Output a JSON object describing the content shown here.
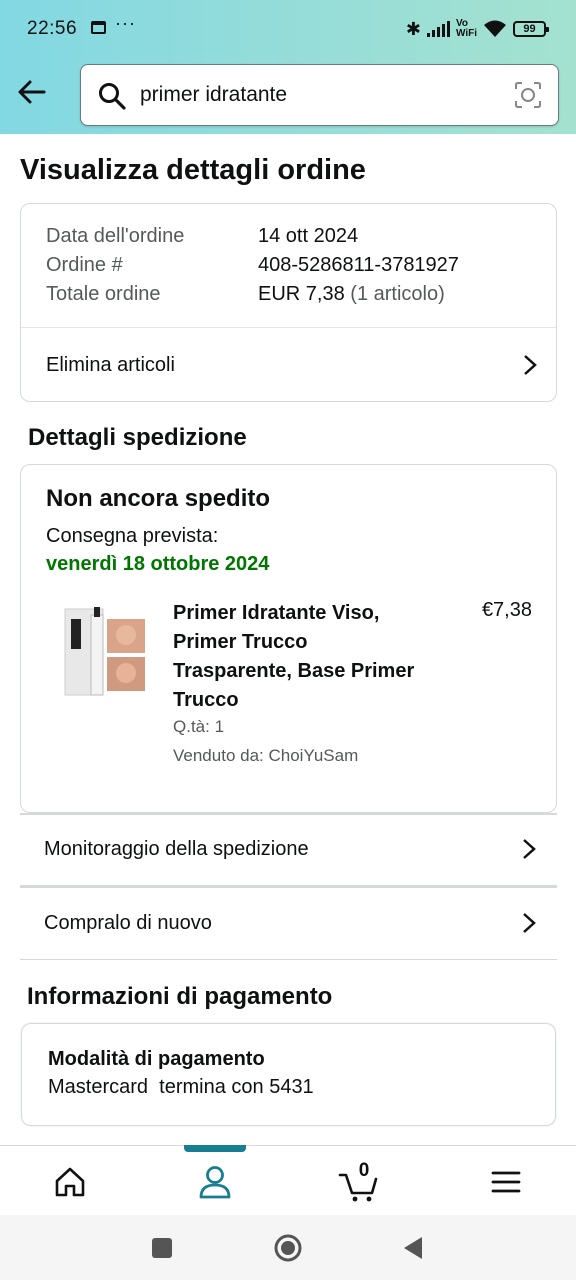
{
  "status_bar": {
    "time": "22:56",
    "more": "···",
    "network_label": "Vo\nWiFi",
    "battery": "99"
  },
  "search": {
    "query": "primer idratante"
  },
  "page": {
    "title": "Visualizza dettagli ordine"
  },
  "order_summary": {
    "rows": [
      {
        "label": "Data dell'ordine",
        "value": "14 ott 2024"
      },
      {
        "label": "Ordine #",
        "value": "408-5286811-3781927"
      },
      {
        "label": "Totale ordine",
        "value": "EUR 7,38",
        "extra": "(1 articolo)"
      }
    ],
    "delete_items": "Elimina articoli"
  },
  "shipping": {
    "section_title": "Dettagli spedizione",
    "status": "Non ancora spedito",
    "eta_label": "Consegna prevista:",
    "eta_date": "venerdì 18 ottobre 2024",
    "product": {
      "name": "Primer Idratante Viso, Primer Trucco Trasparente, Base Primer Trucco",
      "price": "€7,38",
      "qty": "Q.tà: 1",
      "seller": "Venduto da: ChoiYuSam"
    },
    "tracking": "Monitoraggio della spedizione",
    "buy_again": "Compralo di nuovo"
  },
  "payment": {
    "section_title": "Informazioni di pagamento",
    "method_label": "Modalità di pagamento",
    "method_value": "Mastercard  termina con 5431"
  },
  "bottom_nav": {
    "cart_count": "0",
    "active_color": "#167e90"
  },
  "colors": {
    "header_gradient_start": "#82d8e3",
    "header_gradient_end": "#a4e2cf",
    "delivery_green": "#007600"
  }
}
